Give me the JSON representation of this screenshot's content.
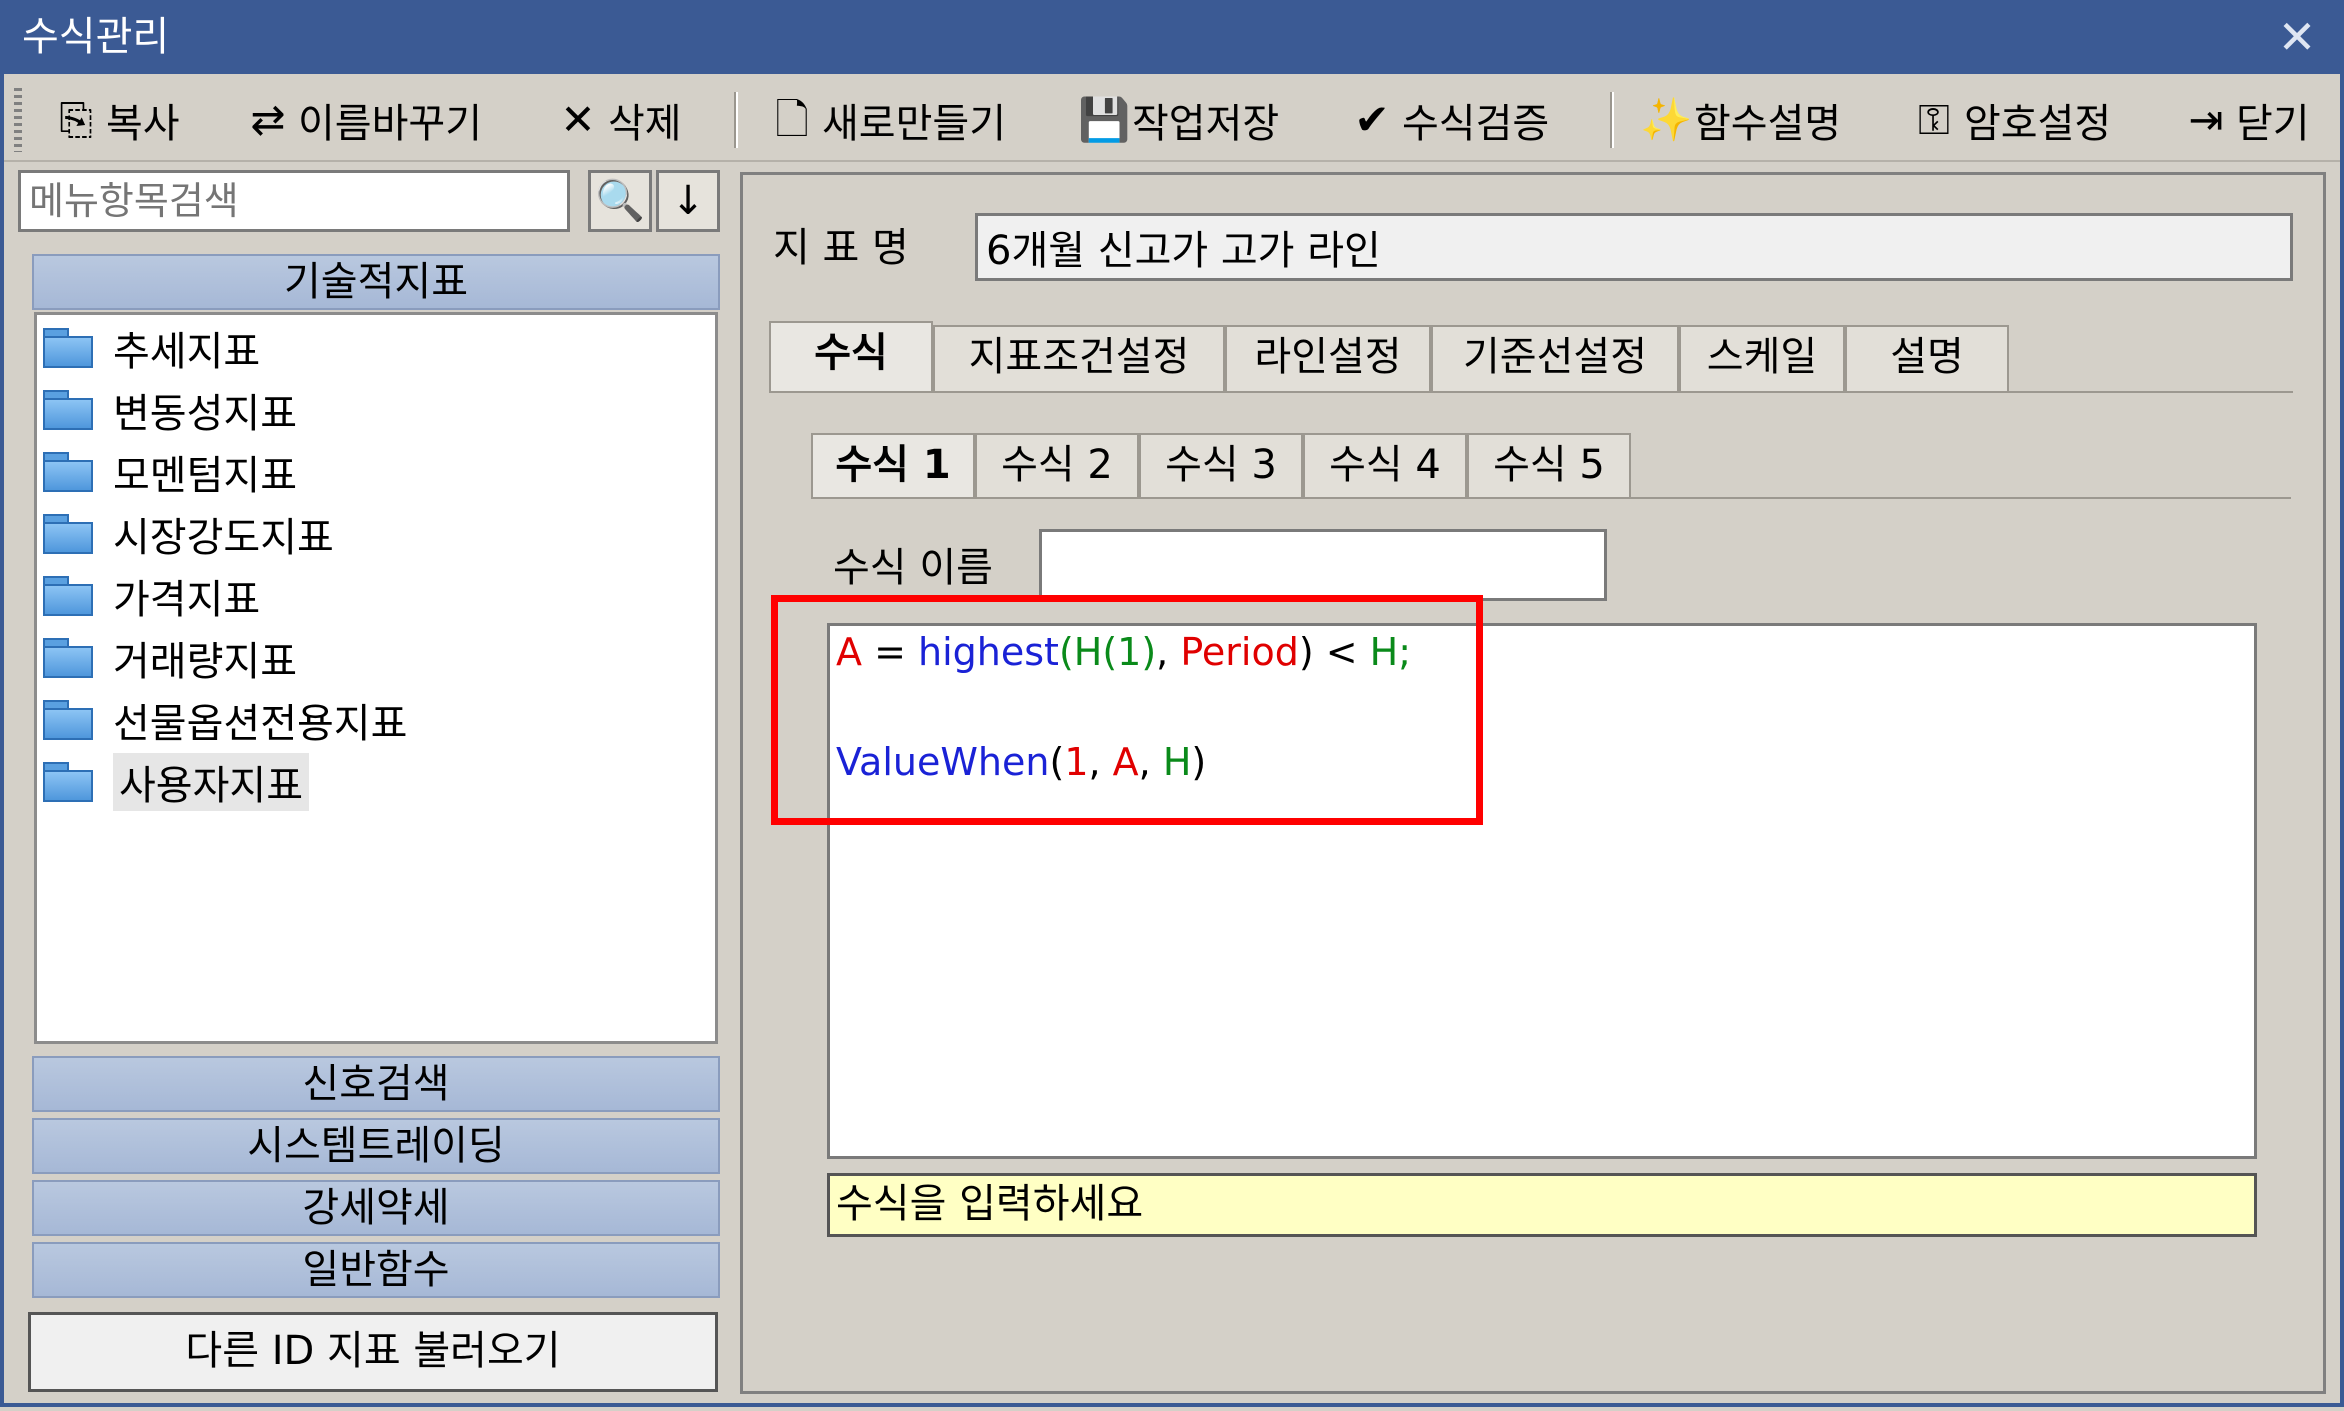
{
  "window": {
    "title": "수식관리",
    "close": "✕"
  },
  "toolbar": {
    "copy": "복사",
    "rename": "이름바꾸기",
    "delete": "삭제",
    "new": "새로만들기",
    "save": "작업저장",
    "verify": "수식검증",
    "func_help": "함수설명",
    "password": "암호설정",
    "close": "닫기"
  },
  "left": {
    "search_placeholder": "메뉴항목검색",
    "category_top": "기술적지표",
    "tree": [
      "추세지표",
      "변동성지표",
      "모멘텀지표",
      "시장강도지표",
      "가격지표",
      "거래량지표",
      "선물옵션전용지표",
      "사용자지표"
    ],
    "categories": [
      "신호검색",
      "시스템트레이딩",
      "강세약세",
      "일반함수"
    ],
    "load_button": "다른 ID 지표 불러오기"
  },
  "right": {
    "name_label": "지 표 명",
    "name_value": "6개월 신고가 고가 라인",
    "tabs": [
      "수식",
      "지표조건설정",
      "라인설정",
      "기준선설정",
      "스케일",
      "설명"
    ],
    "subtabs": [
      "수식 1",
      "수식 2",
      "수식 3",
      "수식 4",
      "수식 5"
    ],
    "formula_name_label": "수식 이름",
    "formula_name_value": "",
    "code": {
      "l1": {
        "a": "A",
        "eq": " = ",
        "fn": "highest",
        "p1": "(",
        "h1": "H(1)",
        "c1": ", ",
        "period": "Period",
        "p2": ") < ",
        "h2": "H;"
      },
      "l2": {
        "fn": "ValueWhen",
        "p1": "(",
        "one": "1",
        "c1": ", ",
        "a": "A",
        "c2": ", ",
        "h": "H",
        "p2": ")"
      }
    },
    "status": "수식을 입력하세요"
  },
  "colors": {
    "titlebar": "#3b5a94",
    "highlight": "#ff0000",
    "status_bg": "#ffffc4"
  }
}
